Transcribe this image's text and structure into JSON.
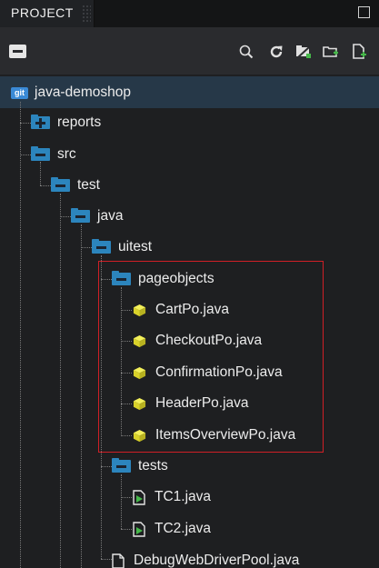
{
  "panel": {
    "title": "PROJECT"
  },
  "toolbar": {
    "icons": [
      "collapse-all-icon",
      "search-icon",
      "refresh-icon",
      "filter-icon",
      "new-folder-icon",
      "new-file-icon"
    ]
  },
  "colors": {
    "folder": "#2c85bd",
    "git_badge": "#3a8ad6",
    "selection": "#263848",
    "highlight_box": "#d01f26",
    "class_icon": "#e8e337",
    "file_icon_green": "#46b84a"
  },
  "tree": {
    "root": {
      "badge": "git",
      "label": "java-demoshop"
    },
    "reports": "reports",
    "src": "src",
    "test": "test",
    "java": "java",
    "uitest": "uitest",
    "pageobjects": "pageobjects",
    "page_files": [
      "CartPo.java",
      "CheckoutPo.java",
      "ConfirmationPo.java",
      "HeaderPo.java",
      "ItemsOverviewPo.java"
    ],
    "tests": "tests",
    "test_files": [
      "TC1.java",
      "TC2.java"
    ],
    "debug_file": "DebugWebDriverPool.java"
  }
}
